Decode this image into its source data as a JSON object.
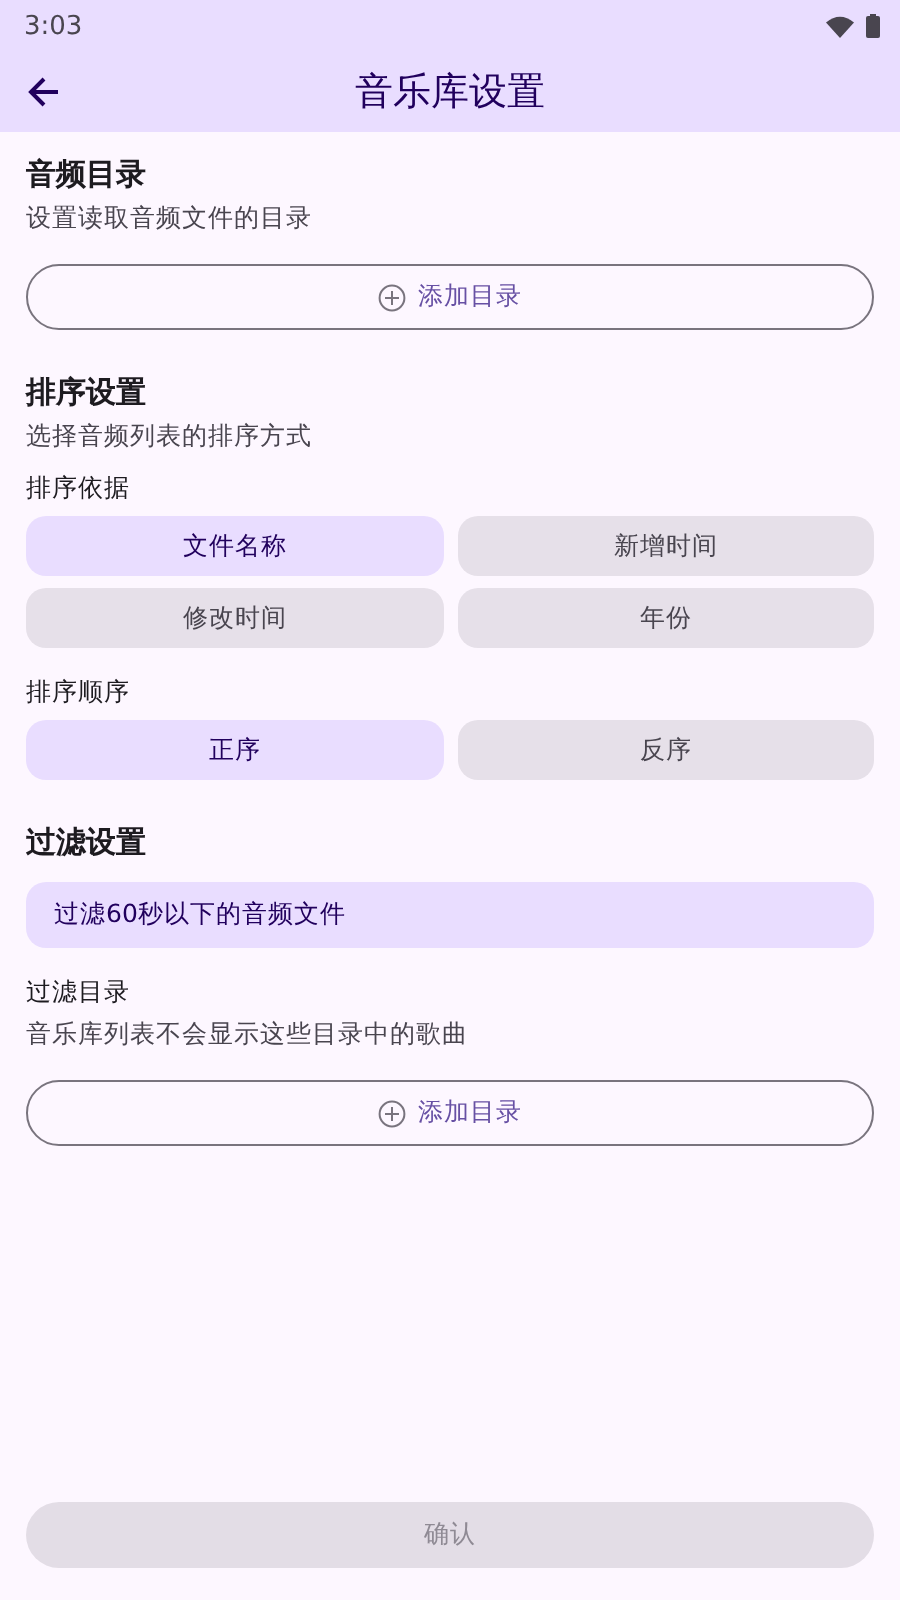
{
  "status_bar": {
    "time": "3:03"
  },
  "app_bar": {
    "title": "音乐库设置"
  },
  "audio_dirs": {
    "title": "音频目录",
    "description": "设置读取音频文件的目录",
    "add_button": "添加目录"
  },
  "sorting": {
    "title": "排序设置",
    "description": "选择音频列表的排序方式",
    "sort_by": {
      "label": "排序依据",
      "options": [
        {
          "label": "文件名称",
          "selected": true
        },
        {
          "label": "新增时间",
          "selected": false
        },
        {
          "label": "修改时间",
          "selected": false
        },
        {
          "label": "年份",
          "selected": false
        }
      ]
    },
    "sort_order": {
      "label": "排序顺序",
      "options": [
        {
          "label": "正序",
          "selected": true
        },
        {
          "label": "反序",
          "selected": false
        }
      ]
    }
  },
  "filter": {
    "title": "过滤设置",
    "short_audio": {
      "label": "过滤60秒以下的音频文件",
      "selected": true
    },
    "excluded_dirs": {
      "label": "过滤目录",
      "description": "音乐库列表不会显示这些目录中的歌曲",
      "add_button": "添加目录"
    }
  },
  "confirm_button": {
    "label": "确认",
    "disabled": true
  }
}
